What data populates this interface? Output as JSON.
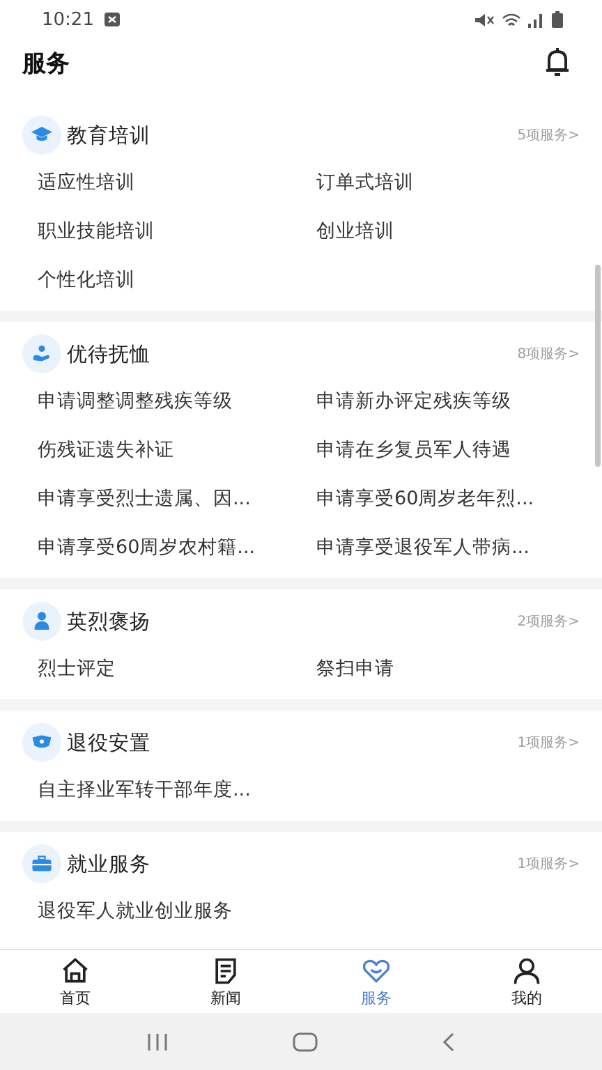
{
  "status_bar": {
    "time": "10:21"
  },
  "header": {
    "title": "服务"
  },
  "sections": [
    {
      "title": "教育培训",
      "count": "5项服务>",
      "items": [
        "适应性培训",
        "订单式培训",
        "职业技能培训",
        "创业培训",
        "个性化培训"
      ]
    },
    {
      "title": "优待抚恤",
      "count": "8项服务>",
      "items": [
        "申请调整调整残疾等级",
        "申请新办评定残疾等级",
        "伤残证遗失补证",
        "申请在乡复员军人待遇",
        "申请享受烈士遗属、因...",
        "申请享受60周岁老年烈...",
        "申请享受60周岁农村籍...",
        "申请享受退役军人带病..."
      ]
    },
    {
      "title": "英烈褒扬",
      "count": "2项服务>",
      "items": [
        "烈士评定",
        "祭扫申请"
      ]
    },
    {
      "title": "退役安置",
      "count": "1项服务>",
      "items": [
        "自主择业军转干部年度..."
      ]
    },
    {
      "title": "就业服务",
      "count": "1项服务>",
      "items": [
        "退役军人就业创业服务"
      ]
    }
  ],
  "tabs": [
    {
      "label": "首页",
      "selected": false
    },
    {
      "label": "新闻",
      "selected": false
    },
    {
      "label": "服务",
      "selected": true
    },
    {
      "label": "我的",
      "selected": false
    }
  ]
}
